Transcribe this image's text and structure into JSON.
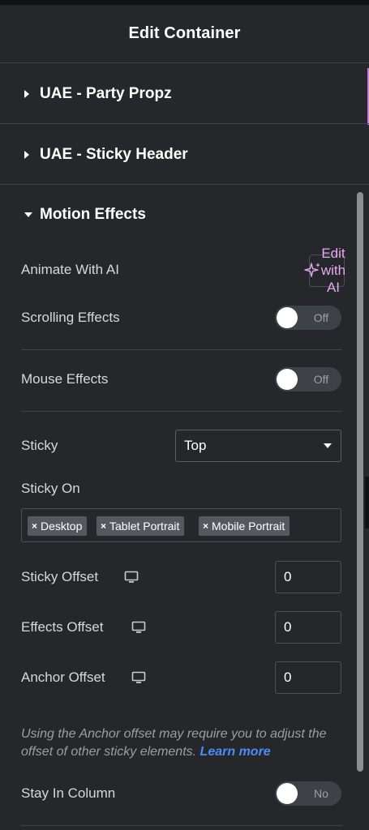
{
  "header": {
    "title": "Edit Container"
  },
  "sections": [
    {
      "label": "UAE - Party Propz",
      "expanded": false
    },
    {
      "label": "UAE - Sticky Header",
      "expanded": false
    },
    {
      "label": "Motion Effects",
      "expanded": true
    }
  ],
  "motion": {
    "animate_ai": {
      "label": "Animate With AI",
      "button_text": "Edit with AI",
      "button_lines": [
        "Edit",
        "with",
        "AI"
      ]
    },
    "scrolling": {
      "label": "Scrolling Effects",
      "state": "Off"
    },
    "mouse": {
      "label": "Mouse Effects",
      "state": "Off"
    },
    "sticky": {
      "label": "Sticky",
      "value": "Top"
    },
    "sticky_on": {
      "label": "Sticky On",
      "tags": [
        "Desktop",
        "Tablet Portrait",
        "Mobile Portrait"
      ]
    },
    "sticky_offset": {
      "label": "Sticky Offset",
      "value": "0"
    },
    "effects_offset": {
      "label": "Effects Offset",
      "value": "0"
    },
    "anchor_offset": {
      "label": "Anchor Offset",
      "value": "0"
    },
    "note": {
      "text": "Using the Anchor offset may require you to adjust the offset of other sticky elements.",
      "link": "Learn more"
    },
    "stay_in_column": {
      "label": "Stay In Column",
      "state": "No"
    }
  },
  "colors": {
    "background": "#26272b",
    "accent_ai": "#e7a7f2",
    "link": "#4d8cf5",
    "divider": "#3f444b"
  },
  "icons": {
    "collapsed": "caret-right-icon",
    "expanded": "caret-down-icon",
    "device": "monitor-icon",
    "ai": "sparkle-icon",
    "select": "chevron-down-icon",
    "remove_tag": "close-icon"
  }
}
